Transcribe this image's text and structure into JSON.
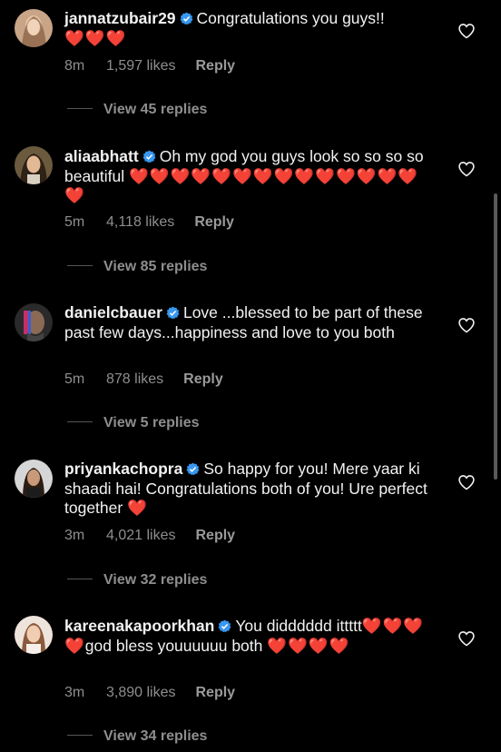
{
  "comments": [
    {
      "username": "jannatzubair29",
      "text_before": "Congratulations you guys!!",
      "line2": "",
      "hearts": "❤️❤️❤️",
      "time": "8m",
      "likes": "1,597 likes",
      "reply": "Reply",
      "view_replies": "View 45 replies"
    },
    {
      "username": "aliaabhatt",
      "text_before": "Oh my god you guys look so so so so beautiful",
      "hearts": "❤️❤️❤️❤️❤️❤️❤️❤️❤️❤️❤️❤️❤️❤️❤️",
      "time": "5m",
      "likes": "4,118 likes",
      "reply": "Reply",
      "view_replies": "View 85 replies"
    },
    {
      "username": "danielcbauer",
      "text_before": "Love ...blessed to be part of these past few days...happiness and love to you both",
      "hearts": "",
      "time": "5m",
      "likes": "878 likes",
      "reply": "Reply",
      "view_replies": "View 5 replies"
    },
    {
      "username": "priyankachopra",
      "text_before": "So happy for you! Mere yaar ki shaadi hai! Congratulations both of you! Ure perfect together",
      "hearts": "❤️",
      "time": "3m",
      "likes": "4,021 likes",
      "reply": "Reply",
      "view_replies": "View 32 replies"
    },
    {
      "username": "kareenakapoorkhan",
      "text_before": "You didddddd ittttt",
      "hearts_mid": "❤️❤️❤️❤️",
      "text_after": "god bless youuuuuu both",
      "hearts": "❤️❤️❤️❤️",
      "time": "3m",
      "likes": "3,890 likes",
      "reply": "Reply",
      "view_replies": "View 34 replies"
    }
  ],
  "colors": {
    "background": "#000000",
    "text": "#f2f2f2",
    "muted": "#8e8e8e",
    "verified": "#3897f0",
    "heart": "#e8232f"
  },
  "icons": {
    "verified": "verified-badge-icon",
    "like": "heart-outline-icon"
  }
}
